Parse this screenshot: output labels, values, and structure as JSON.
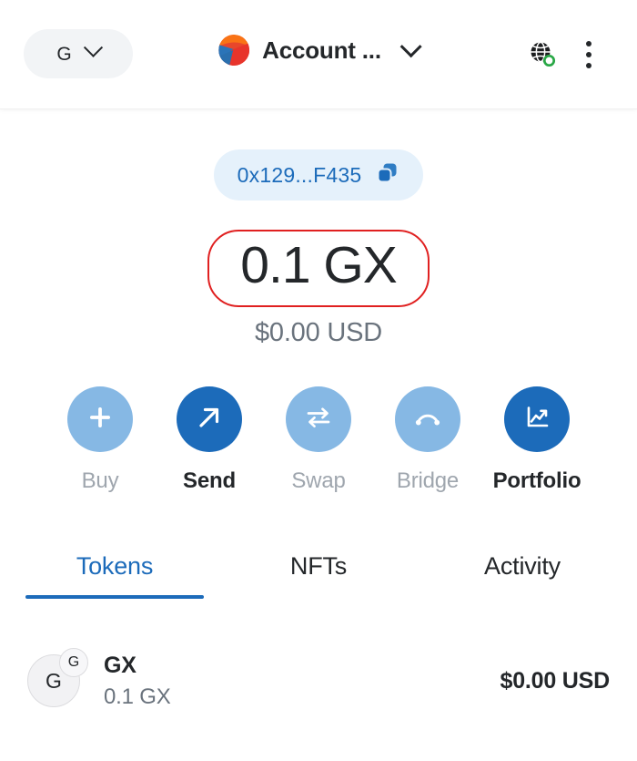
{
  "header": {
    "network_selector": {
      "label": "G",
      "icon": "chevron-down-icon"
    },
    "account": {
      "name": "Account ...",
      "avatar_icon": "account-blockie-avatar",
      "chevron_icon": "chevron-down-icon"
    },
    "connection": {
      "icon": "globe-icon",
      "status_color": "#28a745"
    },
    "menu": {
      "icon": "kebab-menu-icon"
    }
  },
  "address": {
    "text": "0x129...F435",
    "copy_icon": "copy-icon",
    "background": "#e5f1fb",
    "text_color": "#1c6bba"
  },
  "balance": {
    "primary": "0.1 GX",
    "secondary": "$0.00 USD",
    "highlight_color": "#e02020"
  },
  "actions": [
    {
      "id": "buy",
      "label": "Buy",
      "icon": "plus-icon",
      "enabled": false
    },
    {
      "id": "send",
      "label": "Send",
      "icon": "arrow-up-right-icon",
      "enabled": true
    },
    {
      "id": "swap",
      "label": "Swap",
      "icon": "swap-arrows-icon",
      "enabled": false
    },
    {
      "id": "bridge",
      "label": "Bridge",
      "icon": "bridge-arc-icon",
      "enabled": false
    },
    {
      "id": "portfolio",
      "label": "Portfolio",
      "icon": "chart-line-icon",
      "enabled": true
    }
  ],
  "tabs": [
    {
      "id": "tokens",
      "label": "Tokens",
      "active": true
    },
    {
      "id": "nfts",
      "label": "NFTs",
      "active": false
    },
    {
      "id": "activity",
      "label": "Activity",
      "active": false
    }
  ],
  "tokens": [
    {
      "symbol": "GX",
      "name": "GX",
      "amount": "0.1 GX",
      "fiat": "$0.00 USD",
      "icon_letter": "G",
      "badge_letter": "G"
    }
  ],
  "colors": {
    "accent": "#1c6bba",
    "accent_disabled": "#86b8e4",
    "text_primary": "#24272a",
    "text_muted": "#6a737d",
    "pill_bg": "#f2f4f6"
  }
}
